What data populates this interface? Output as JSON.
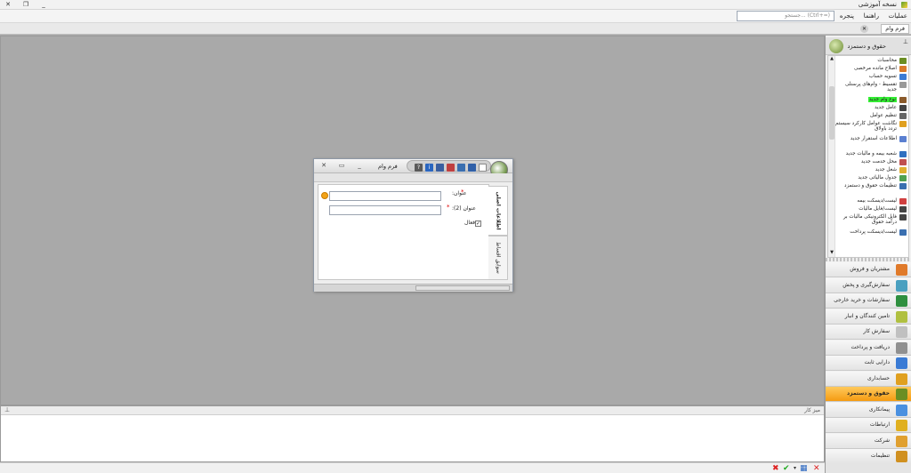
{
  "app": {
    "title": "نسخه آموزشی"
  },
  "window_controls": {
    "close": "✕",
    "restore": "❐",
    "minimize": "_"
  },
  "menu": {
    "items": [
      "عملیات",
      "راهنما",
      "پنجره"
    ],
    "search_placeholder": "جستجو... (Ctrl+=)"
  },
  "tabs": {
    "active": "فرم وام",
    "close": "✕"
  },
  "bottom_panel": {
    "title": "میز کار",
    "pin": "⊥"
  },
  "sidebar": {
    "title": "حقوق و دستمزد",
    "pin": "⊥",
    "items": [
      {
        "label": "محاسبات",
        "color": "#6b8e23"
      },
      {
        "label": "اصلاح مانده مرخصی",
        "color": "#d97a2b"
      },
      {
        "label": "تسویه حساب",
        "color": "#3a7bd5"
      },
      {
        "label": "تقسیط - وام‌های پرسنلی جدید",
        "color": "#999999"
      },
      {
        "label": "نوع وام جدید",
        "color": "#8a5a2b",
        "highlight": true
      },
      {
        "label": "عامل جدید",
        "color": "#444444"
      },
      {
        "label": "تنظیم عوامل",
        "color": "#666666"
      },
      {
        "label": "نگاشت عوامل کارکرد سیستم تردد باولاق",
        "color": "#e0a020"
      },
      {
        "label": "اطلاعات استقرار جدید",
        "color": "#5a7fd0"
      },
      {
        "label": "شعبه بیمه و مالیات جدید",
        "color": "#3070c0"
      },
      {
        "label": "محل خدمت جدید",
        "color": "#c05050"
      },
      {
        "label": "شغل جدید",
        "color": "#e0b030"
      },
      {
        "label": "جدول مالیاتی جدید",
        "color": "#50a050"
      },
      {
        "label": "تنظیمات حقوق و دستمزد",
        "color": "#3a6fb0"
      },
      {
        "label": "لیست/دیسکت بیمه",
        "color": "#d04040"
      },
      {
        "label": "لیست/فایل مالیات",
        "color": "#444444"
      },
      {
        "label": "فایل الکترونیکی مالیات بر درآمد حقوق",
        "color": "#444444"
      },
      {
        "label": "لیست/دیسکت پرداخت",
        "color": "#3a6fb0"
      }
    ]
  },
  "nav": [
    {
      "label": "مشتریان و فروش",
      "color": "#e07a2a"
    },
    {
      "label": "سفارش‌گیری و پخش",
      "color": "#4aa0c0"
    },
    {
      "label": "سفارشات و خرید خارجی",
      "color": "#2f8f3f"
    },
    {
      "label": "تامین کنندگان و انبار",
      "color": "#b0c040"
    },
    {
      "label": "سفارش کار",
      "color": "#c0c0c0"
    },
    {
      "label": "دریافت و پرداخت",
      "color": "#909090"
    },
    {
      "label": "دارایی ثابت",
      "color": "#3a7bd5"
    },
    {
      "label": "حسابداری",
      "color": "#e0a020"
    },
    {
      "label": "حقوق و دستمزد",
      "color": "#6b8e23",
      "active": true
    },
    {
      "label": "پیمانکاری",
      "color": "#4a90e0"
    },
    {
      "label": "ارتباطات",
      "color": "#e0b020"
    },
    {
      "label": "شرکت",
      "color": "#e0a030"
    },
    {
      "label": "تنظیمات",
      "color": "#d09020"
    }
  ],
  "dialog": {
    "title": "فرم وام",
    "tabs": [
      "اطلاعات اصلی",
      "سوابق اقساط"
    ],
    "fields": {
      "title_label": "عنوان:",
      "title2_label": "عنوان (2):",
      "active_label": "فعال",
      "required_mark": "*",
      "title_value": "",
      "title2_value": ""
    },
    "toolbar_icons": [
      "new-icon",
      "save-icon",
      "save-as-icon",
      "delete-icon",
      "print-icon",
      "info-icon",
      "help-icon"
    ]
  },
  "status_icons": [
    "close-icon",
    "calculator-icon",
    "dropdown-icon",
    "confirm-icon",
    "cancel-icon"
  ]
}
